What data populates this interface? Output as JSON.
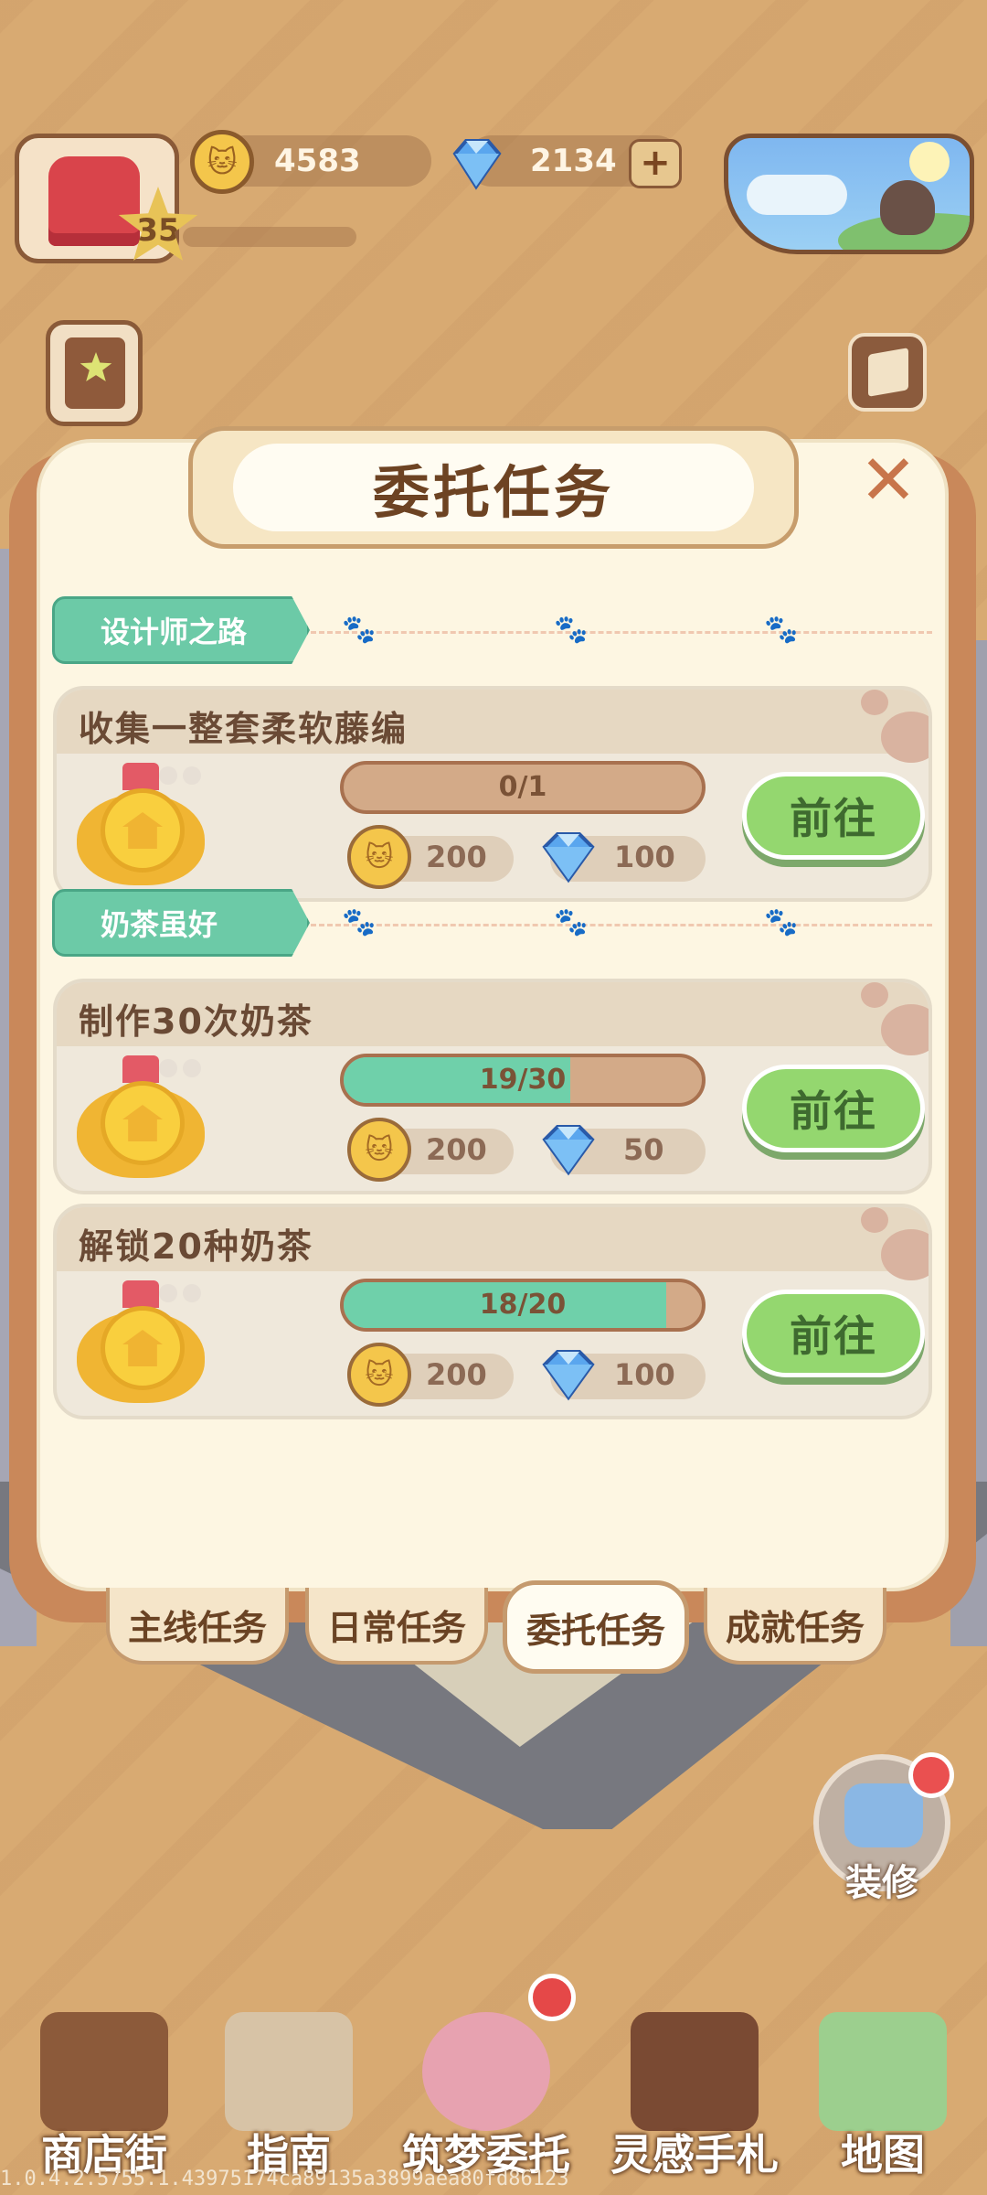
{
  "hud": {
    "level": "35",
    "coins": "4583",
    "gems": "2134",
    "plus_label": "+"
  },
  "panel": {
    "title": "委托任务",
    "close_label": "✕"
  },
  "sections": [
    {
      "label": "设计师之路"
    },
    {
      "label": "奶茶虽好"
    }
  ],
  "tasks": [
    {
      "name": "收集一整套柔软藤编",
      "progress_text": "0/1",
      "progress": 0.0,
      "coin_reward": "200",
      "gem_reward": "100",
      "button": "前往"
    },
    {
      "name": "制作30次奶茶",
      "progress_text": "19/30",
      "progress": 0.633,
      "coin_reward": "200",
      "gem_reward": "50",
      "button": "前往"
    },
    {
      "name": "解锁20种奶茶",
      "progress_text": "18/20",
      "progress": 0.9,
      "coin_reward": "200",
      "gem_reward": "100",
      "button": "前往"
    }
  ],
  "tabs": [
    {
      "label": "主线任务",
      "active": false
    },
    {
      "label": "日常任务",
      "active": false
    },
    {
      "label": "委托任务",
      "active": true
    },
    {
      "label": "成就任务",
      "active": false
    }
  ],
  "decor_button": {
    "label": "装修"
  },
  "nav": [
    {
      "label": "商店街",
      "icon": "shop-icon",
      "color": "#8c5a3a"
    },
    {
      "label": "指南",
      "icon": "guide-icon",
      "color": "#d7c3a6"
    },
    {
      "label": "筑梦委托",
      "icon": "notebook-icon",
      "color": "#e7a2b0"
    },
    {
      "label": "灵感手札",
      "icon": "inspiration-book-icon",
      "color": "#7a4a33"
    },
    {
      "label": "地图",
      "icon": "map-icon",
      "color": "#9ccf8e"
    }
  ],
  "version": "1.0.4.2.5755.1.43975174ca89135a3899aea80fd86123",
  "colors": {
    "background": "#d8aa72",
    "panel": "#fdf6e2",
    "accent_green": "#94d76f",
    "progress_fill": "#6fd0aa",
    "section_tag": "#6ccaa7"
  }
}
